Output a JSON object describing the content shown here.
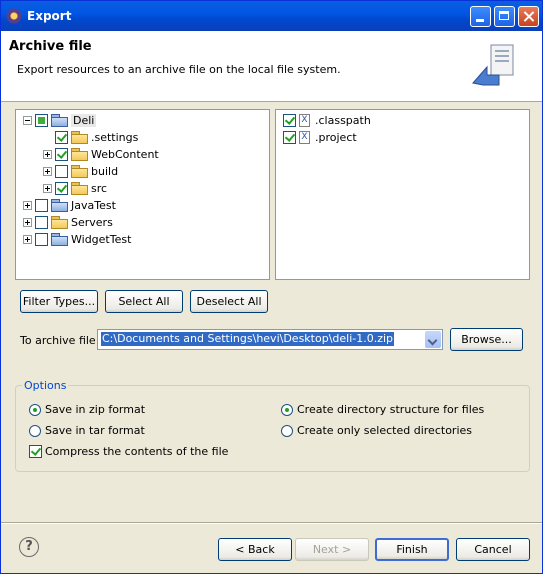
{
  "window": {
    "title": "Export"
  },
  "banner": {
    "title": "Archive file",
    "description": "Export resources to an archive file on the local file system."
  },
  "left_tree": [
    {
      "label": "Deli",
      "kind": "project",
      "expander": "minus",
      "check": "gray",
      "selected": true
    },
    {
      "label": ".settings",
      "kind": "folder",
      "expander": "none",
      "check": "checked"
    },
    {
      "label": "WebContent",
      "kind": "folder",
      "expander": "plus",
      "check": "checked"
    },
    {
      "label": "build",
      "kind": "folder",
      "expander": "plus",
      "check": "unchecked"
    },
    {
      "label": "src",
      "kind": "folder",
      "expander": "plus",
      "check": "checked"
    },
    {
      "label": "JavaTest",
      "kind": "project",
      "expander": "plus",
      "check": "unchecked"
    },
    {
      "label": "Servers",
      "kind": "folder",
      "expander": "plus",
      "check": "unchecked"
    },
    {
      "label": "WidgetTest",
      "kind": "project",
      "expander": "plus",
      "check": "unchecked"
    }
  ],
  "right_list": [
    {
      "label": ".classpath",
      "check": "checked",
      "icon": "x-file-icon"
    },
    {
      "label": ".project",
      "check": "checked",
      "icon": "x-file-icon"
    }
  ],
  "selection_buttons": {
    "filter_types": "Filter Types...",
    "select_all": "Select All",
    "deselect_all": "Deselect All"
  },
  "archive": {
    "label": "To archive file:",
    "value": "C:\\Documents and Settings\\hevi\\Desktop\\deli-1.0.zip",
    "browse": "Browse..."
  },
  "options": {
    "title": "Options",
    "zip": "Save in zip format",
    "tar": "Save in tar format",
    "compress": "Compress the contents of the file",
    "dir_structure": "Create directory structure for files",
    "selected_dirs": "Create only selected directories",
    "zip_selected": true,
    "dir_structure_selected": true,
    "compress_checked": true
  },
  "footer": {
    "back": "< Back",
    "next": "Next >",
    "finish": "Finish",
    "cancel": "Cancel",
    "help_icon": "help-icon"
  },
  "colors": {
    "title_bar": "#0054e3",
    "accent": "#0046d5",
    "selection": "#316ac5",
    "check": "#21a121"
  }
}
